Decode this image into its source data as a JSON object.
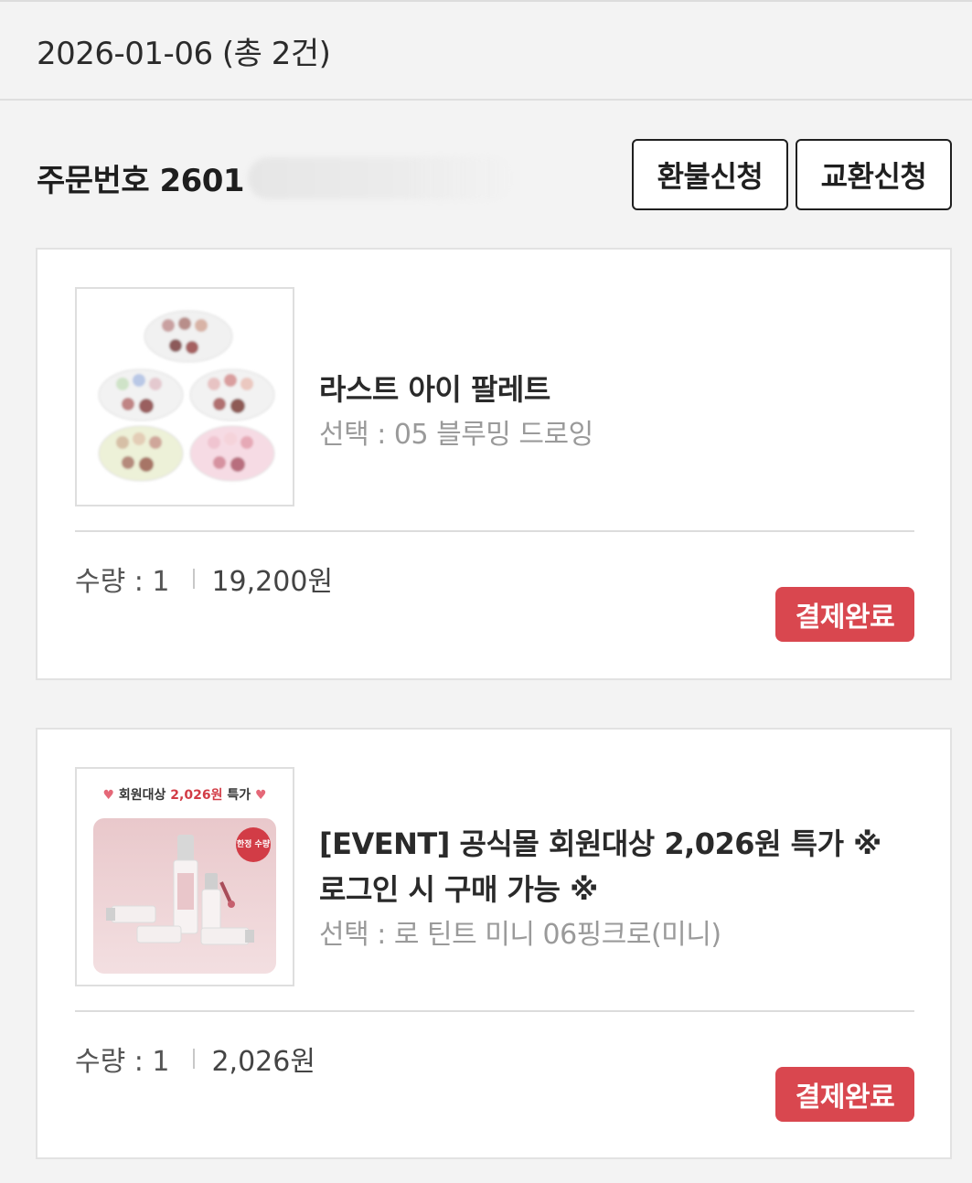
{
  "date_header": "2026-01-06 (총 2건)",
  "order": {
    "number_label": "주문번호 2601",
    "refund_button": "환불신청",
    "exchange_button": "교환신청"
  },
  "items": [
    {
      "title": "라스트 아이 팔레트",
      "option": "선택 : 05 블루밍 드로잉",
      "quantity": "수량 : 1",
      "price": "19,200원",
      "status": "결제완료"
    },
    {
      "title_line1": "[EVENT] 공식몰 회원대상 2,026원 특가 ※",
      "title_line2": "로그인 시 구매 가능 ※",
      "option": "선택 : 로 틴트 미니 06핑크로(미니)",
      "quantity": "수량 : 1",
      "price": "2,026원",
      "status": "결제완료",
      "banner_prefix": "회원대상 ",
      "banner_price": "2,026원",
      "banner_suffix": " 특가",
      "limited_badge": "한정 수량"
    }
  ],
  "colors": {
    "status_badge": "#d9474f",
    "background": "#f3f3f3"
  }
}
